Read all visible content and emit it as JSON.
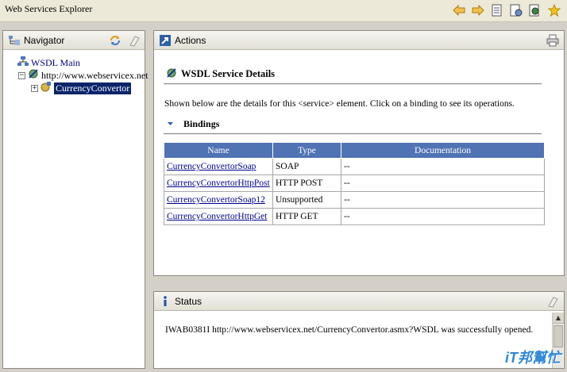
{
  "window": {
    "title": "Web Services Explorer"
  },
  "toolbar": {
    "icons": [
      "back-arrow-icon",
      "forward-arrow-icon",
      "uddi-page-icon",
      "wsil-page-icon",
      "wsdl-page-icon",
      "favorites-star-icon"
    ]
  },
  "navigator": {
    "title": "Navigator",
    "tree": {
      "root_label": "WSDL Main",
      "service_label": "http://www.webservicex.net",
      "service_expander": "−",
      "binding_label": "CurrencyConvertor",
      "binding_expander": "+"
    }
  },
  "actions": {
    "title": "Actions",
    "details_title": "WSDL Service Details",
    "description": "Shown below are the details for this <service> element. Click on a binding to see its operations.",
    "bindings_title": "Bindings",
    "table": {
      "headers": [
        "Name",
        "Type",
        "Documentation"
      ],
      "rows": [
        {
          "name": "CurrencyConvertorSoap",
          "type": "SOAP",
          "doc": "--"
        },
        {
          "name": "CurrencyConvertorHttpPost",
          "type": "HTTP POST",
          "doc": "--"
        },
        {
          "name": "CurrencyConvertorSoap12",
          "type": "Unsupported",
          "doc": "--"
        },
        {
          "name": "CurrencyConvertorHttpGet",
          "type": "HTTP GET",
          "doc": "--"
        }
      ]
    }
  },
  "status": {
    "title": "Status",
    "message": "IWAB0381I http://www.webservicex.net/CurrencyConvertor.asmx?WSDL was successfully opened."
  },
  "watermark": "iT邦幫忙",
  "colors": {
    "table_header": "#4f73b3",
    "selection": "#0a246a",
    "link": "#00008b"
  }
}
